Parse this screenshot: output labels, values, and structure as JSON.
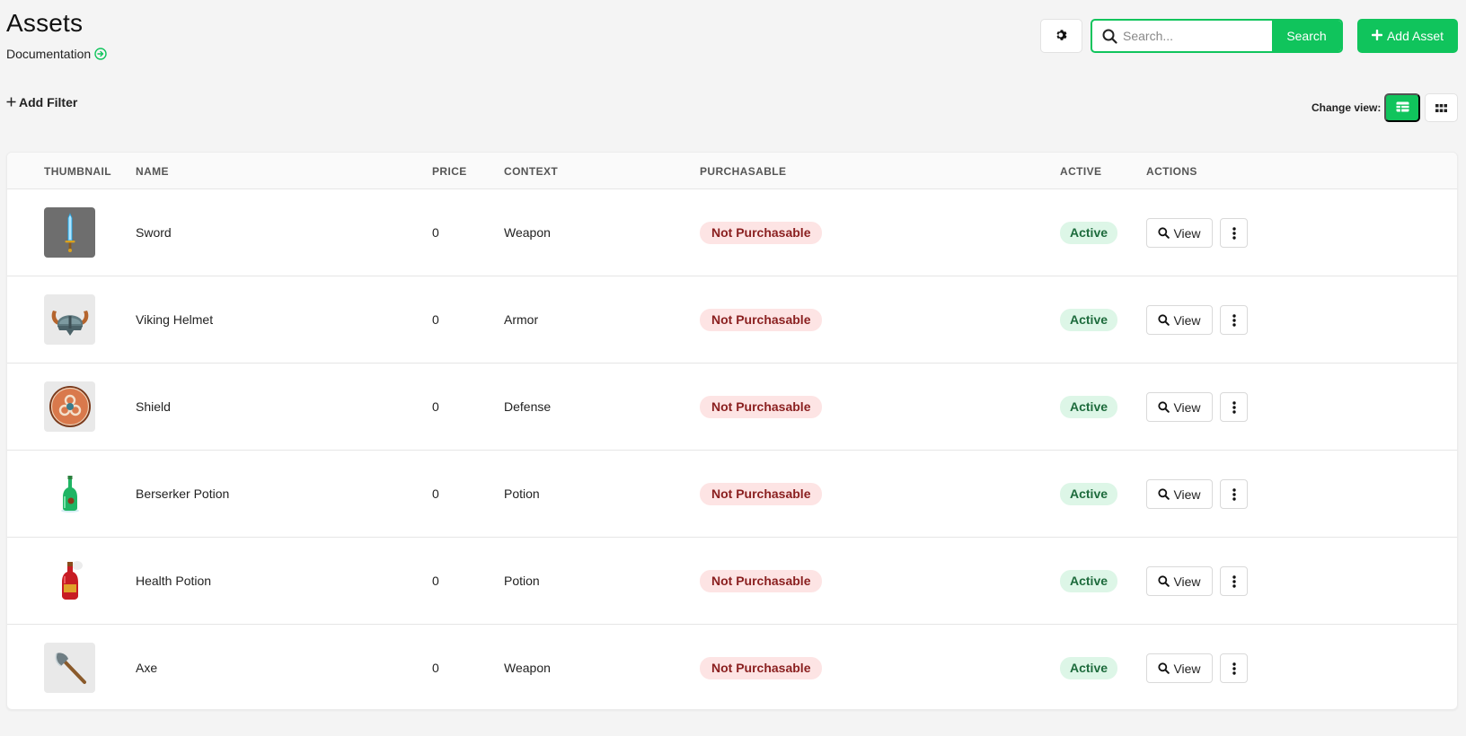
{
  "header": {
    "title": "Assets",
    "documentation_label": "Documentation",
    "search_placeholder": "Search...",
    "search_button": "Search",
    "add_asset_button": "Add Asset",
    "add_filter_label": "Add Filter",
    "change_view_label": "Change view:"
  },
  "colors": {
    "accent": "#10c45c",
    "not_purchasable_bg": "#fde4e4",
    "not_purchasable_text": "#8a1f1f",
    "active_bg": "#ddf6e7",
    "active_text": "#1d6b3c"
  },
  "table": {
    "columns": [
      "THUMBNAIL",
      "NAME",
      "PRICE",
      "CONTEXT",
      "PURCHASABLE",
      "ACTIVE",
      "ACTIONS"
    ],
    "rows": [
      {
        "thumbnail": "sword-icon",
        "name": "Sword",
        "price": "0",
        "context": "Weapon",
        "purchasable": "Not Purchasable",
        "active": "Active",
        "view": "View"
      },
      {
        "thumbnail": "viking-helmet-icon",
        "name": "Viking Helmet",
        "price": "0",
        "context": "Armor",
        "purchasable": "Not Purchasable",
        "active": "Active",
        "view": "View"
      },
      {
        "thumbnail": "shield-icon",
        "name": "Shield",
        "price": "0",
        "context": "Defense",
        "purchasable": "Not Purchasable",
        "active": "Active",
        "view": "View"
      },
      {
        "thumbnail": "green-potion-icon",
        "name": "Berserker Potion",
        "price": "0",
        "context": "Potion",
        "purchasable": "Not Purchasable",
        "active": "Active",
        "view": "View"
      },
      {
        "thumbnail": "red-potion-icon",
        "name": "Health Potion",
        "price": "0",
        "context": "Potion",
        "purchasable": "Not Purchasable",
        "active": "Active",
        "view": "View"
      },
      {
        "thumbnail": "axe-icon",
        "name": "Axe",
        "price": "0",
        "context": "Weapon",
        "purchasable": "Not Purchasable",
        "active": "Active",
        "view": "View"
      }
    ]
  }
}
